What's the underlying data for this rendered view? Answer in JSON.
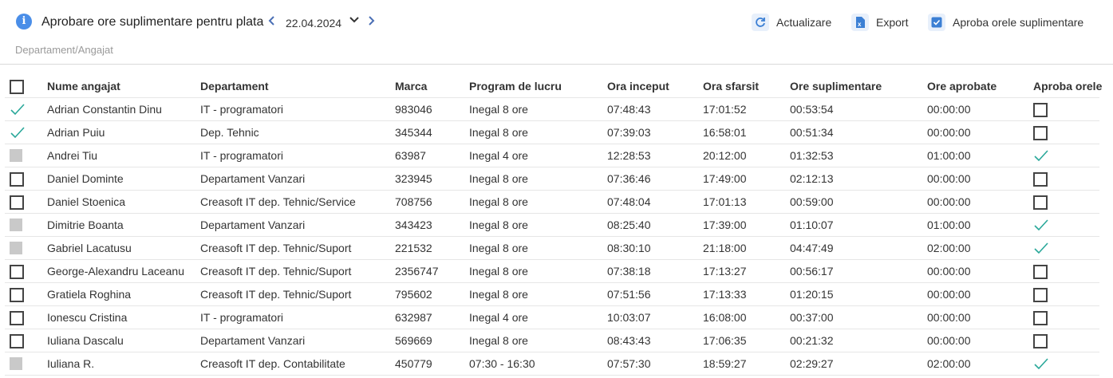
{
  "header": {
    "title": "Aprobare ore suplimentare pentru plata",
    "date": "22.04.2024",
    "refresh_label": "Actualizare",
    "export_label": "Export",
    "approve_label": "Aproba orele suplimentare",
    "breadcrumb": "Departament/Angajat"
  },
  "accent_color": "#2aa89a",
  "columns": [
    "Nume angajat",
    "Departament",
    "Marca",
    "Program de lucru",
    "Ora inceput",
    "Ora sfarsit",
    "Ore suplimentare",
    "Ore aprobate",
    "Aproba orele"
  ],
  "rows": [
    {
      "select": "check",
      "name": "Adrian Constantin Dinu",
      "dep": "IT - programatori",
      "marca": "983046",
      "prog": "Inegal 8 ore",
      "start": "07:48:43",
      "end": "17:01:52",
      "ore": "00:53:54",
      "apr": "00:00:00",
      "approve": "box"
    },
    {
      "select": "check",
      "name": "Adrian Puiu",
      "dep": "Dep. Tehnic",
      "marca": "345344",
      "prog": "Inegal 8 ore",
      "start": "07:39:03",
      "end": "16:58:01",
      "ore": "00:51:34",
      "apr": "00:00:00",
      "approve": "box"
    },
    {
      "select": "gray",
      "name": "Andrei Tiu",
      "dep": "IT - programatori",
      "marca": "63987",
      "prog": "Inegal 4 ore",
      "start": "12:28:53",
      "end": "20:12:00",
      "ore": "01:32:53",
      "apr": "01:00:00",
      "approve": "check"
    },
    {
      "select": "box",
      "name": "Daniel Dominte",
      "dep": "Departament Vanzari",
      "marca": "323945",
      "prog": "Inegal 8 ore",
      "start": "07:36:46",
      "end": "17:49:00",
      "ore": "02:12:13",
      "apr": "00:00:00",
      "approve": "box"
    },
    {
      "select": "box",
      "name": "Daniel Stoenica",
      "dep": "Creasoft IT dep. Tehnic/Service",
      "marca": "708756",
      "prog": "Inegal 8 ore",
      "start": "07:48:04",
      "end": "17:01:13",
      "ore": "00:59:00",
      "apr": "00:00:00",
      "approve": "box"
    },
    {
      "select": "gray",
      "name": "Dimitrie Boanta",
      "dep": "Departament Vanzari",
      "marca": "343423",
      "prog": "Inegal 8 ore",
      "start": "08:25:40",
      "end": "17:39:00",
      "ore": "01:10:07",
      "apr": "01:00:00",
      "approve": "check"
    },
    {
      "select": "gray",
      "name": "Gabriel Lacatusu",
      "dep": "Creasoft IT dep. Tehnic/Suport",
      "marca": "221532",
      "prog": "Inegal 8 ore",
      "start": "08:30:10",
      "end": "21:18:00",
      "ore": "04:47:49",
      "apr": "02:00:00",
      "approve": "check"
    },
    {
      "select": "box",
      "name": "George-Alexandru Laceanu",
      "dep": "Creasoft IT dep. Tehnic/Suport",
      "marca": "2356747",
      "prog": "Inegal 8 ore",
      "start": "07:38:18",
      "end": "17:13:27",
      "ore": "00:56:17",
      "apr": "00:00:00",
      "approve": "box"
    },
    {
      "select": "box",
      "name": "Gratiela Roghina",
      "dep": "Creasoft IT dep. Tehnic/Suport",
      "marca": "795602",
      "prog": "Inegal 8 ore",
      "start": "07:51:56",
      "end": "17:13:33",
      "ore": "01:20:15",
      "apr": "00:00:00",
      "approve": "box"
    },
    {
      "select": "box",
      "name": "Ionescu Cristina",
      "dep": "IT - programatori",
      "marca": "632987",
      "prog": "Inegal 4 ore",
      "start": "10:03:07",
      "end": "16:08:00",
      "ore": "00:37:00",
      "apr": "00:00:00",
      "approve": "box"
    },
    {
      "select": "box",
      "name": "Iuliana Dascalu",
      "dep": "Departament Vanzari",
      "marca": "569669",
      "prog": "Inegal 8 ore",
      "start": "08:43:43",
      "end": "17:06:35",
      "ore": "00:21:32",
      "apr": "00:00:00",
      "approve": "box"
    },
    {
      "select": "gray",
      "name": "Iuliana R.",
      "dep": "Creasoft IT dep. Contabilitate",
      "marca": "450779",
      "prog": "07:30 - 16:30",
      "start": "07:57:30",
      "end": "18:59:27",
      "ore": "02:29:27",
      "apr": "02:00:00",
      "approve": "check"
    }
  ]
}
